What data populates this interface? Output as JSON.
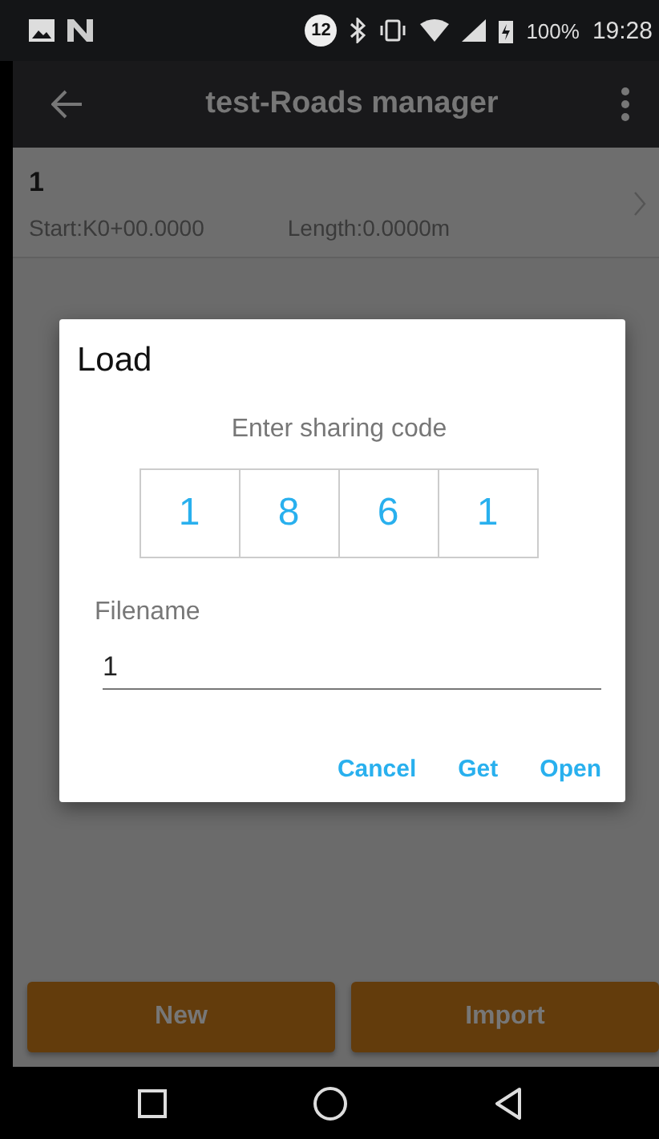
{
  "status_bar": {
    "notification_count": "12",
    "battery": "100%",
    "time": "19:28"
  },
  "app_bar": {
    "title": "test-Roads manager"
  },
  "roads": [
    {
      "name": "1",
      "start": "Start:K0+00.0000",
      "length": "Length:0.0000m"
    }
  ],
  "dialog": {
    "title": "Load",
    "prompt": "Enter sharing code",
    "code_digits": [
      "1",
      "8",
      "6",
      "1"
    ],
    "filename_label": "Filename",
    "filename_value": "1",
    "actions": [
      "Cancel",
      "Get",
      "Open"
    ]
  },
  "bottom_buttons": [
    "New",
    "Import"
  ]
}
